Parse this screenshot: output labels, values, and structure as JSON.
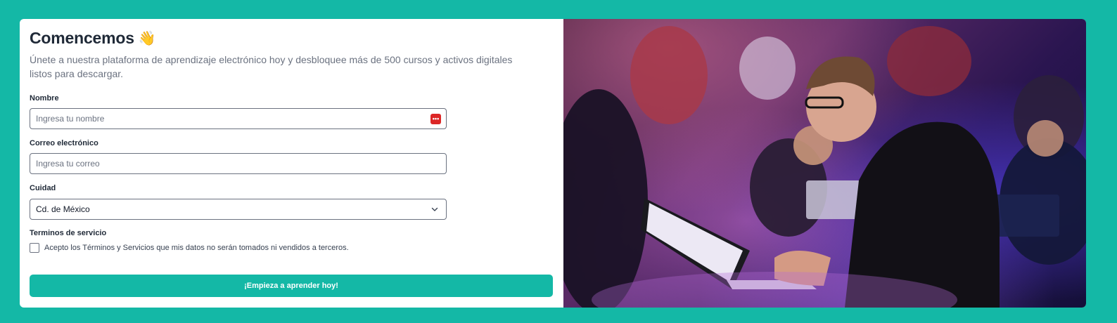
{
  "header": {
    "title": "Comencemos",
    "wave_emoji": "👋",
    "subtitle": "Únete a nuestra plataforma de aprendizaje electrónico hoy y desbloquee más de 500 cursos y activos digitales listos para descargar."
  },
  "form": {
    "name": {
      "label": "Nombre",
      "placeholder": "Ingresa tu nombre",
      "value": "",
      "autofill_badge": "•••"
    },
    "email": {
      "label": "Correo electrónico",
      "placeholder": "Ingresa tu correo",
      "value": ""
    },
    "city": {
      "label": "Cuidad",
      "selected": "Cd. de México"
    },
    "terms": {
      "label": "Terminos de servicio",
      "checkbox_text": "Acepto los Términos y Servicios que mis datos no serán tomados ni vendidos a terceros.",
      "checked": false
    },
    "submit_label": "¡Empieza a aprender hoy!"
  },
  "colors": {
    "accent": "#14b8a6",
    "text_dark": "#1f2937",
    "text_muted": "#6b7280",
    "badge_red": "#dc2626"
  },
  "icons": {
    "select_arrow": "chevron-down-icon",
    "autofill": "password-manager-icon"
  }
}
